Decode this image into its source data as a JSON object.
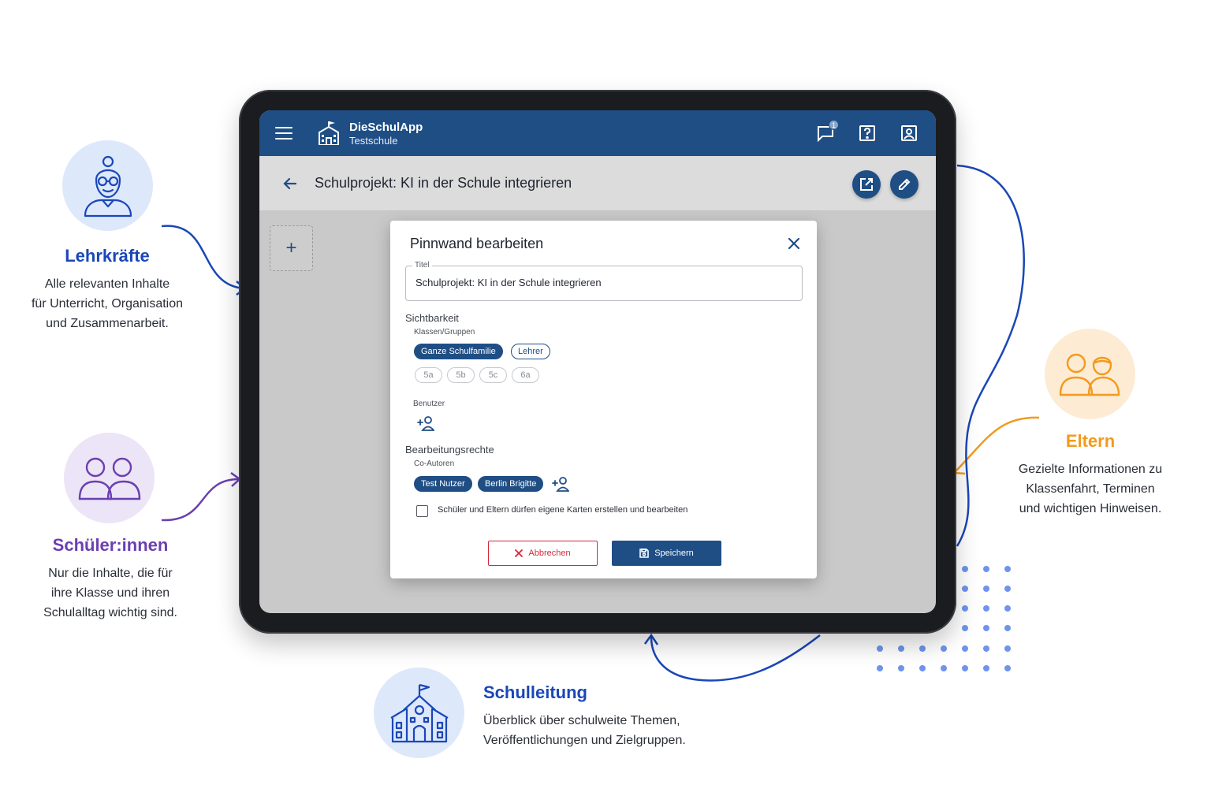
{
  "app": {
    "name": "DieSchulApp",
    "school": "Testschule",
    "notification_count": "1",
    "brand_color": "#1f4e85",
    "icons": [
      "menu-icon",
      "school-logo-icon",
      "chat-icon",
      "help-icon",
      "account-icon"
    ]
  },
  "page": {
    "title": "Schulprojekt: KI in der Schule integrieren",
    "actions": [
      "open-external-icon",
      "edit-icon"
    ],
    "add_label": "+"
  },
  "dialog": {
    "title": "Pinnwand bearbeiten",
    "title_field": {
      "label": "Titel",
      "value": "Schulprojekt: KI in der Schule integrieren"
    },
    "visibility": {
      "label": "Sichtbarkeit",
      "groups_label": "Klassen/Gruppen",
      "groups_selected": [
        "Ganze Schulfamilie",
        "Lehrer"
      ],
      "classes": [
        "5a",
        "5b",
        "5c",
        "6a"
      ],
      "users_label": "Benutzer"
    },
    "edit_rights": {
      "label": "Bearbeitungsrechte",
      "coauthors_label": "Co-Autoren",
      "coauthors": [
        "Test Nutzer",
        "Berlin Brigitte"
      ]
    },
    "checkbox_label": "Schüler und Eltern dürfen eigene Karten erstellen und bearbeiten",
    "checkbox_checked": false,
    "cancel_label": "Abbrechen",
    "save_label": "Speichern",
    "cancel_color": "#d7263d"
  },
  "roles": {
    "teachers": {
      "title": "Lehrkräfte",
      "lines": [
        "Alle relevanten Inhalte",
        "für Unterricht, Organisation",
        "und Zusammenarbeit."
      ],
      "color": "#1a47b8",
      "icon": "teacher-icon"
    },
    "students": {
      "title": "Schüler:innen",
      "lines": [
        "Nur die Inhalte, die für",
        "ihre Klasse und ihren",
        "Schulalltag wichtig sind."
      ],
      "color": "#6b3fb0",
      "icon": "students-icon"
    },
    "parents": {
      "title": "Eltern",
      "lines": [
        "Gezielte Informationen zu",
        "Klassenfahrt, Terminen",
        "und wichtigen Hinweisen."
      ],
      "color": "#f39a1e",
      "icon": "parents-icon"
    },
    "management": {
      "title": "Schulleitung",
      "lines": [
        "Überblick über schulweite Themen,",
        "Veröffentlichungen und Zielgruppen."
      ],
      "color": "#1a47b8",
      "icon": "school-building-icon"
    }
  }
}
